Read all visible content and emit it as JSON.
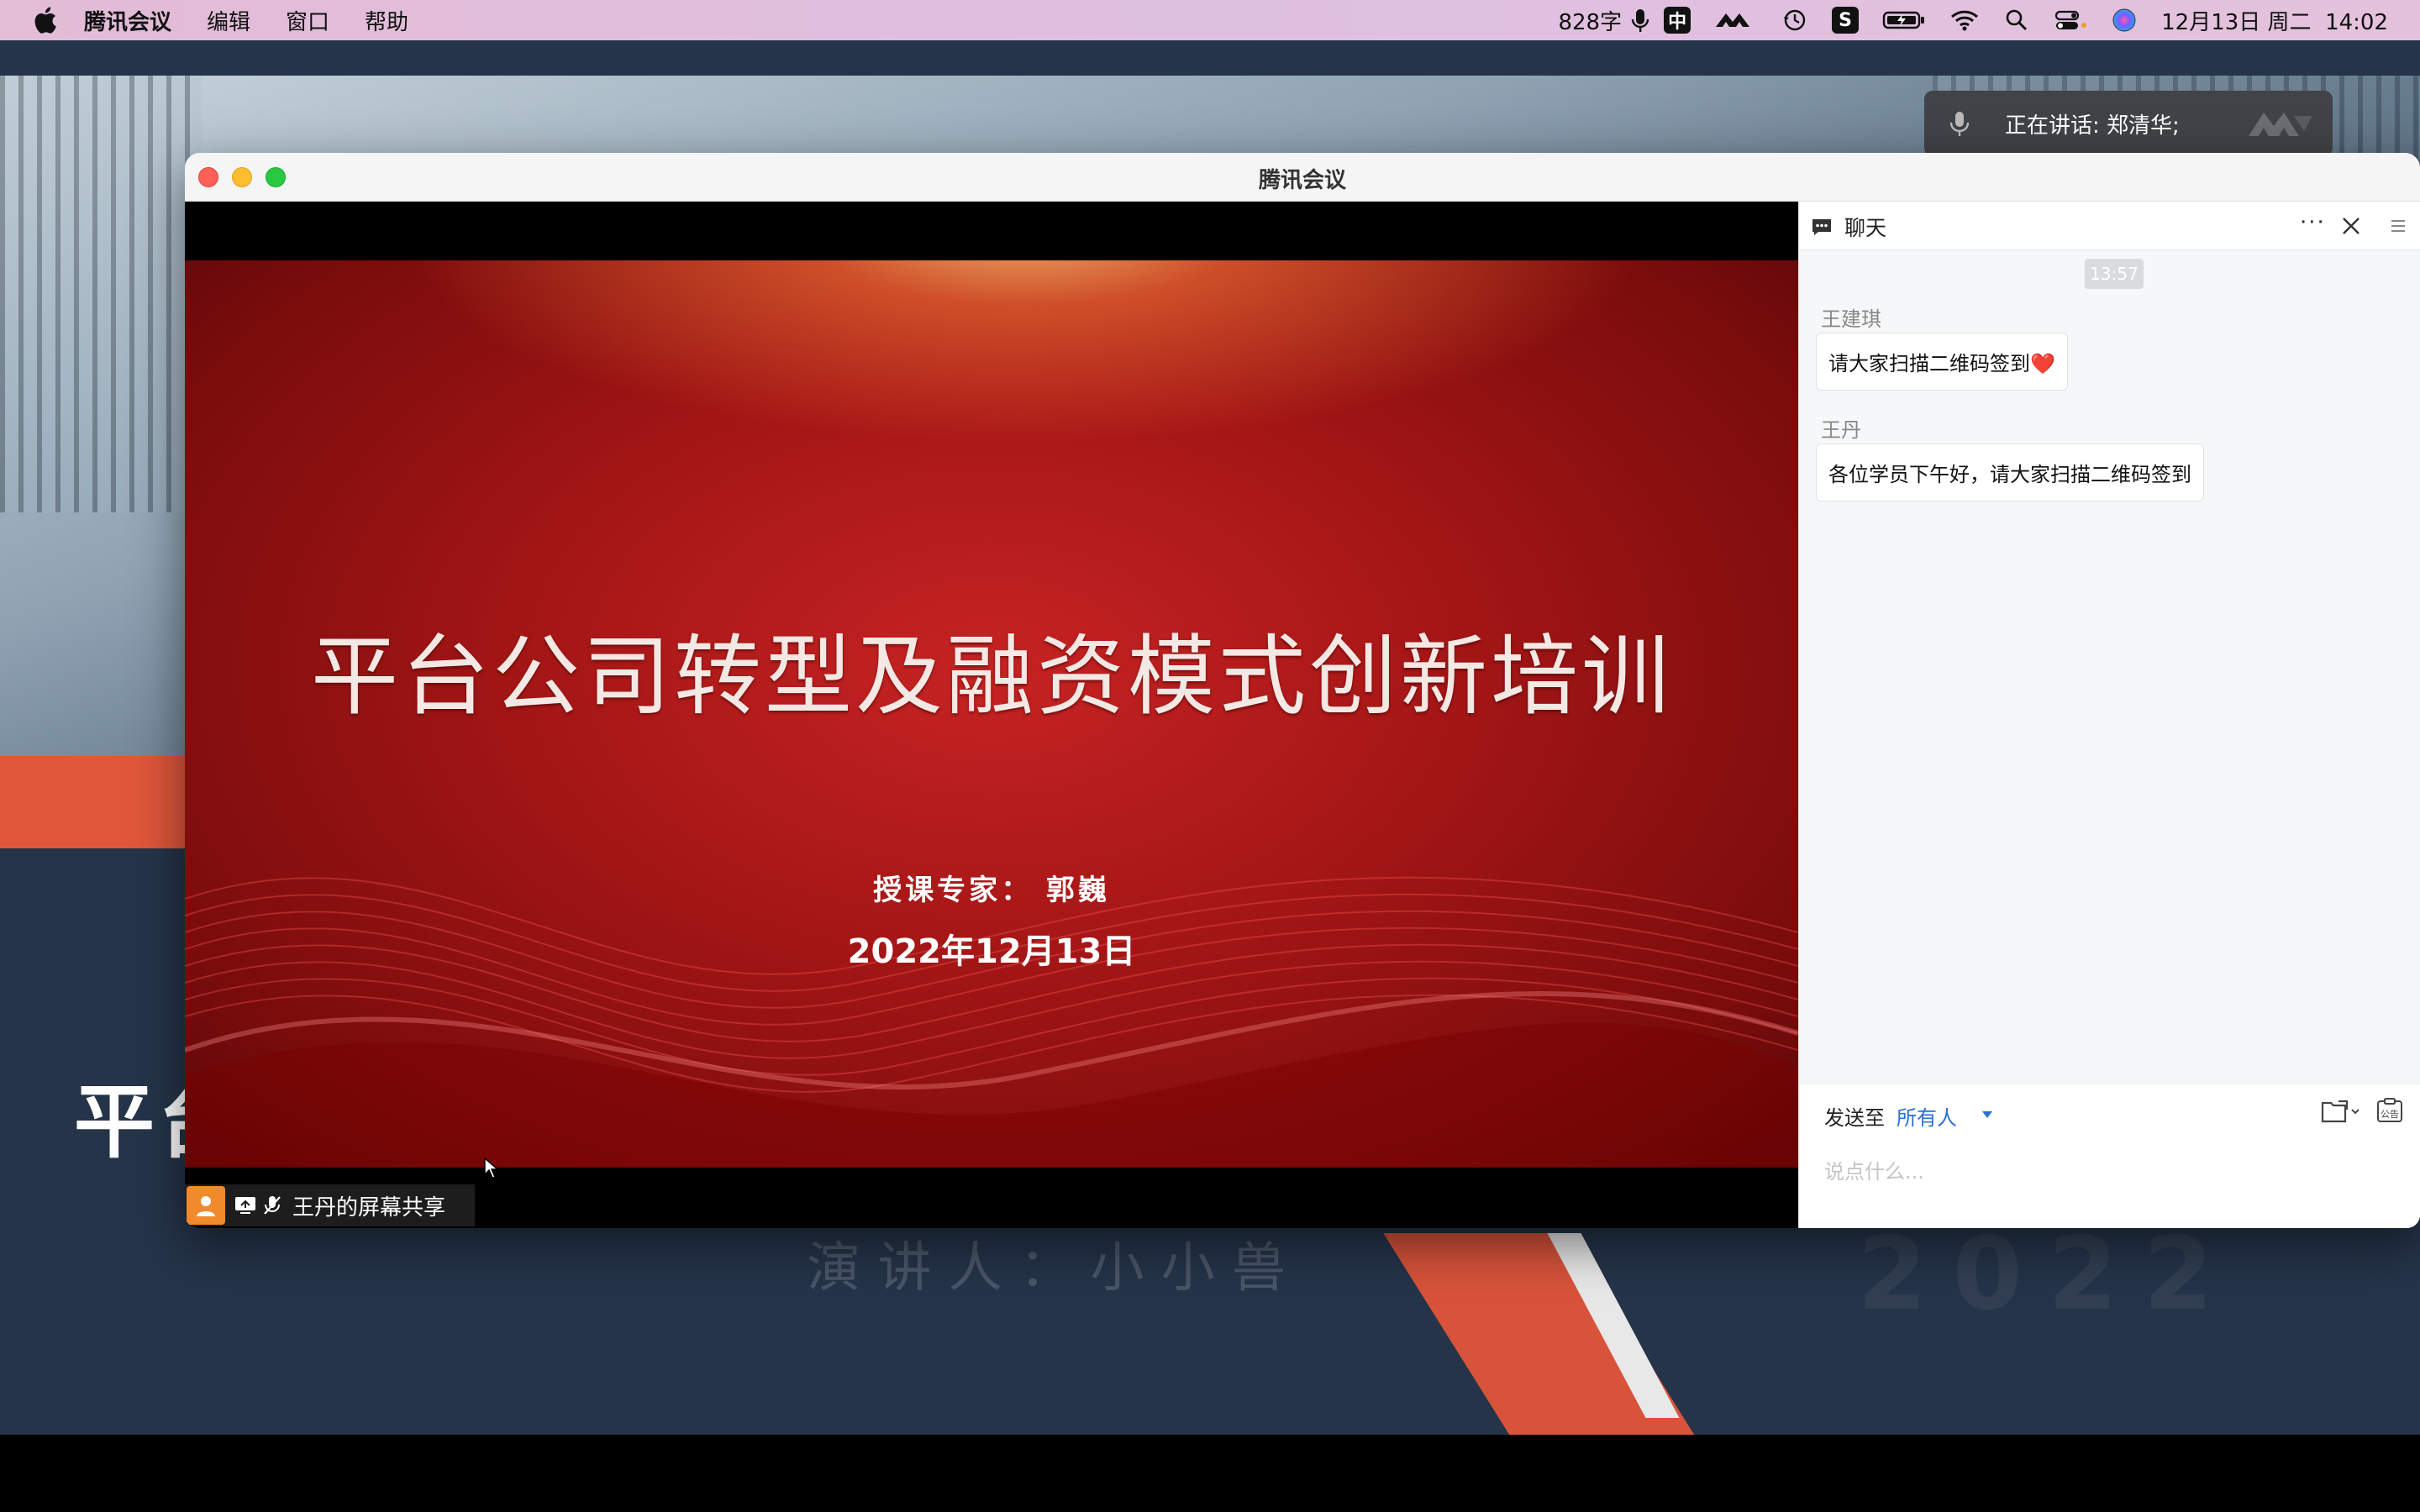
{
  "menubar": {
    "app_name": "腾讯会议",
    "menus": [
      "编辑",
      "窗口",
      "帮助"
    ],
    "word_count": "828字",
    "ime": "中",
    "datetime": "12月13日 周二  14:02"
  },
  "speaking": {
    "text": "正在讲话: 郑清华;"
  },
  "desktop": {
    "title_fragment": "平台",
    "ghost_text": "演 讲 人 ： 小 小 兽",
    "ghost_year": "2022"
  },
  "window": {
    "title": "腾讯会议"
  },
  "slide": {
    "title": "平台公司转型及融资模式创新培训",
    "expert": "授课专家：  郭巍",
    "date": "2022年12月13日"
  },
  "share_tag": {
    "label": "王丹的屏幕共享"
  },
  "chat": {
    "title": "聊天",
    "more": "···",
    "time": "13:57",
    "messages": [
      {
        "sender": "王建琪",
        "text": "请大家扫描二维码签到",
        "emoji": "❤️"
      },
      {
        "sender": "王丹",
        "text": "各位学员下午好，请大家扫描二维码签到"
      }
    ],
    "send_to_label": "发送至",
    "send_to_target": "所有人",
    "input_placeholder": "说点什么...",
    "notice_label": "公告"
  },
  "colors": {
    "accent": "#2b6fd6",
    "desktop_navy": "#253449",
    "desktop_orange": "#e0573b",
    "slide_red": "#a51616"
  }
}
